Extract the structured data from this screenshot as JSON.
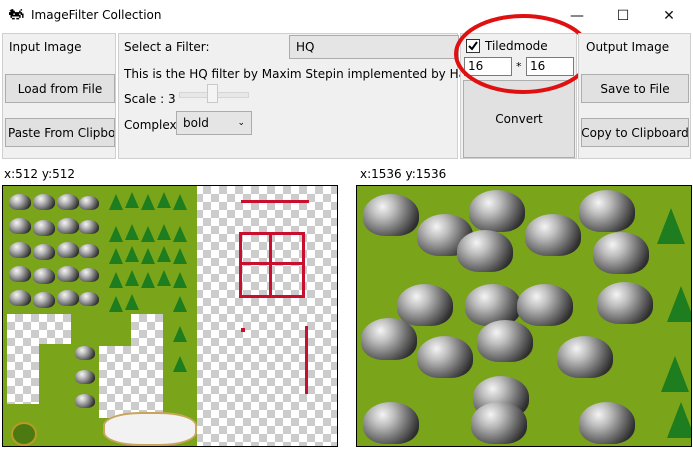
{
  "window": {
    "title": "ImageFilter Collection",
    "minimize": "—",
    "maximize": "☐",
    "close": "✕"
  },
  "input_panel": {
    "label": "Input Image",
    "load_button": "Load from File",
    "paste_button": "Paste From Clipboard"
  },
  "filter_panel": {
    "select_label": "Select a Filter:",
    "selected_filter": "HQ",
    "description": "This is the HQ filter by Maxim Stepin implemented by Hawkynt",
    "scale_label": "Scale : 3",
    "complex_label": "Complex",
    "complex_value": "bold"
  },
  "tile_panel": {
    "tiledmode_label": "Tiledmode",
    "tiledmode_checked": true,
    "tile_width": "16",
    "tile_sep": "*",
    "tile_height": "16",
    "convert_button": "Convert"
  },
  "output_panel": {
    "label": "Output Image",
    "save_button": "Save to File",
    "copy_button": "Copy to Clipboard"
  },
  "source": {
    "dimensions": "x:512 y:512"
  },
  "result": {
    "dimensions": "x:1536 y:1536"
  },
  "colors": {
    "highlight_circle": "#e01010",
    "grass": "#7aa51a",
    "selection_red": "#c8102e",
    "tree": "#1e7d1e"
  },
  "icons": {
    "app": "invader-icon",
    "check": "check-icon",
    "dropdown": "chevron-down-icon"
  }
}
